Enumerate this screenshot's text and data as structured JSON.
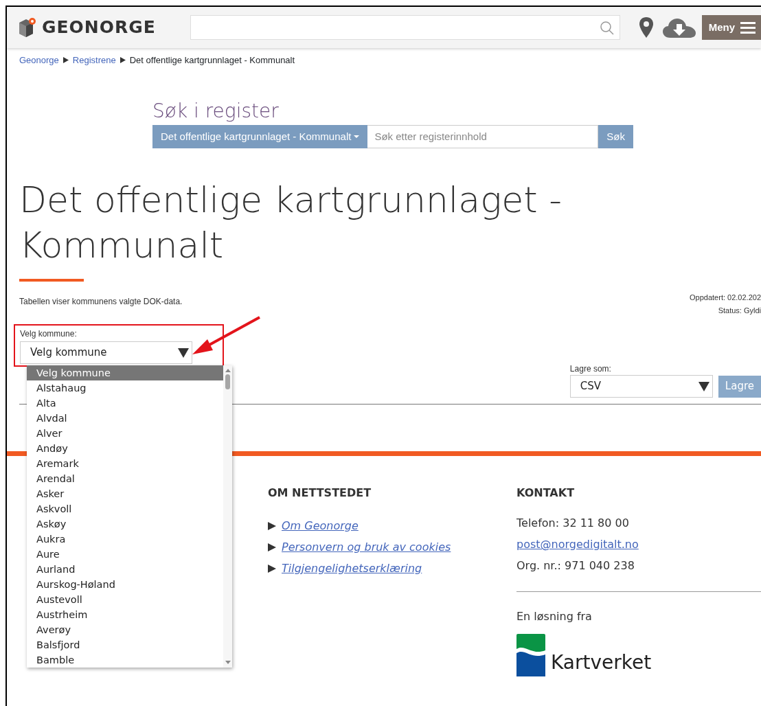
{
  "header": {
    "logo_text": "GEONORGE",
    "menu_button": "Meny"
  },
  "breadcrumb": [
    {
      "label": "Geonorge",
      "kind": "link"
    },
    {
      "label": "Registrene",
      "kind": "link"
    },
    {
      "label": "Det offentlige kartgrunnlaget - Kommunalt",
      "kind": "current"
    }
  ],
  "register_search": {
    "heading": "Søk i register",
    "scope": "Det offentlige kartgrunnlaget - Kommunalt",
    "placeholder": "Søk etter registerinnhold",
    "button": "Søk"
  },
  "title": "Det offentlige kartgrunnlaget - Kommunalt",
  "description": "Tabellen viser kommunens valgte DOK-data.",
  "meta": [
    "Oppdatert: 02.02.202",
    "Status: Gyldi"
  ],
  "municipality_select": {
    "label": "Velg kommune:",
    "value": "Velg kommune",
    "options": [
      {
        "label": "Velg kommune",
        "selected": true
      },
      {
        "label": "Alstahaug",
        "selected": false
      },
      {
        "label": "Alta",
        "selected": false
      },
      {
        "label": "Alvdal",
        "selected": false
      },
      {
        "label": "Alver",
        "selected": false
      },
      {
        "label": "Andøy",
        "selected": false
      },
      {
        "label": "Aremark",
        "selected": false
      },
      {
        "label": "Arendal",
        "selected": false
      },
      {
        "label": "Asker",
        "selected": false
      },
      {
        "label": "Askvoll",
        "selected": false
      },
      {
        "label": "Askøy",
        "selected": false
      },
      {
        "label": "Aukra",
        "selected": false
      },
      {
        "label": "Aure",
        "selected": false
      },
      {
        "label": "Aurland",
        "selected": false
      },
      {
        "label": "Aurskog-Høland",
        "selected": false
      },
      {
        "label": "Austevoll",
        "selected": false
      },
      {
        "label": "Austrheim",
        "selected": false
      },
      {
        "label": "Averøy",
        "selected": false
      },
      {
        "label": "Balsfjord",
        "selected": false
      },
      {
        "label": "Bamble",
        "selected": false
      }
    ]
  },
  "export": {
    "label": "Lagre som:",
    "value": "CSV",
    "button": "Lagre"
  },
  "footer": {
    "about": {
      "heading": "OM NETTSTEDET",
      "links": [
        "Om Geonorge",
        "Personvern og bruk av cookies",
        "Tilgjengelighetserklæring"
      ]
    },
    "contact": {
      "heading": "KONTAKT",
      "lines": [
        {
          "text": "Telefon: 32 11 80 00",
          "kind": "text"
        },
        {
          "text": "post@norgedigitalt.no",
          "kind": "link"
        },
        {
          "text": "Org. nr.: 971 040 238",
          "kind": "text"
        }
      ],
      "credit": "En løsning fra",
      "logo_text": "Kartverket"
    }
  }
}
